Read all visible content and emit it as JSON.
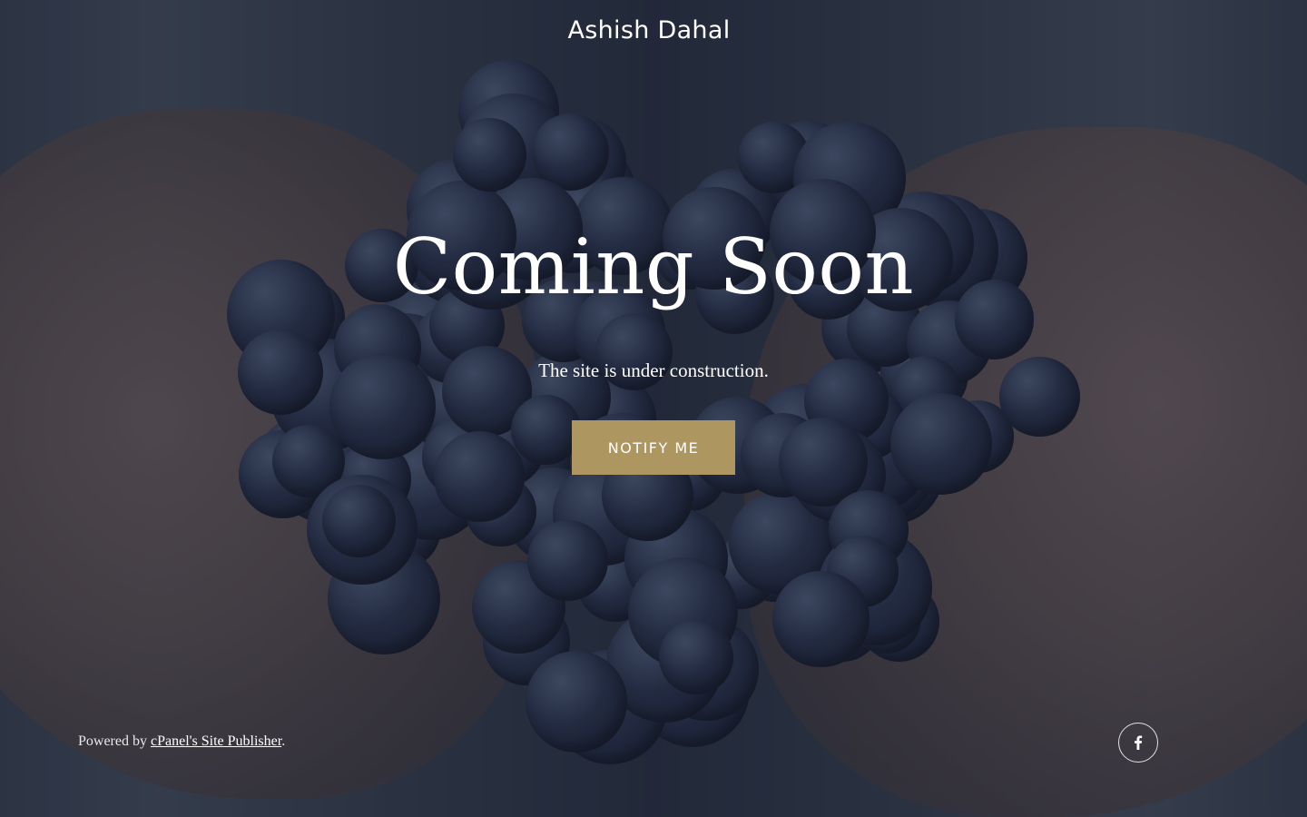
{
  "header": {
    "site_name": "Ashish Dahal"
  },
  "hero": {
    "title": "Coming Soon",
    "subtitle": "The site is under construction.",
    "cta_label": "NOTIFY ME"
  },
  "footer": {
    "powered_by_prefix": "Powered by ",
    "powered_by_link": "cPanel's Site Publisher",
    "powered_by_suffix": ".",
    "social": [
      {
        "icon": "facebook-icon"
      }
    ]
  },
  "colors": {
    "accent": "#ad9660",
    "overlay": "#18203073",
    "text": "#ffffff"
  }
}
